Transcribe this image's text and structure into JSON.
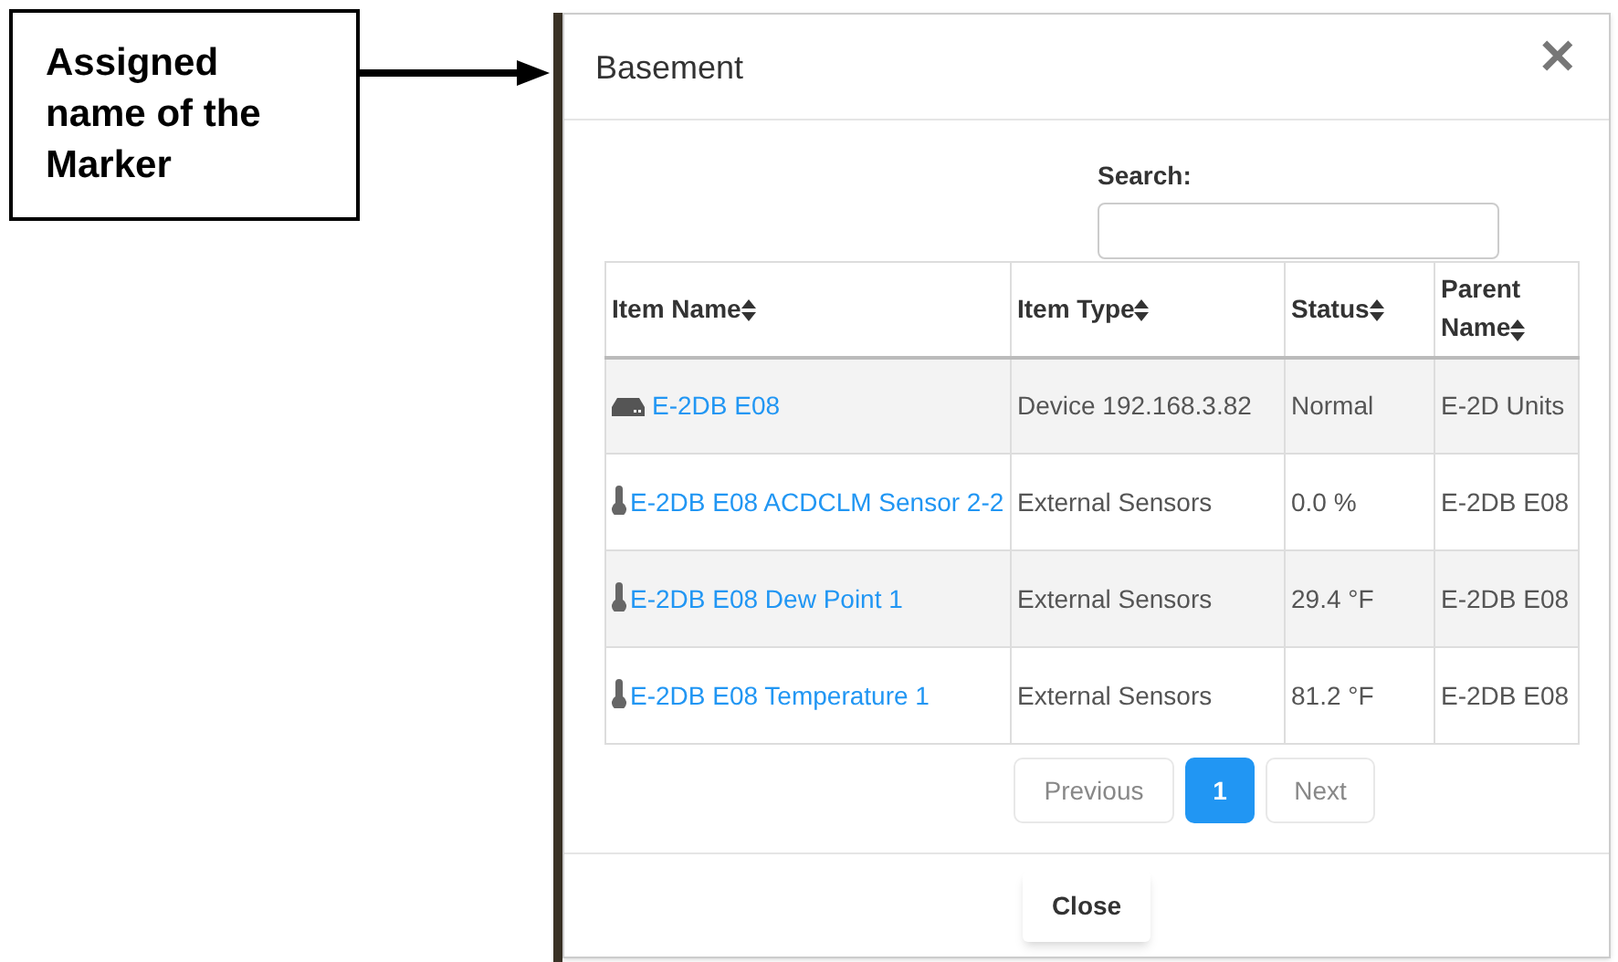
{
  "callout": {
    "text": "Assigned name of the Marker"
  },
  "dialog": {
    "title": "Basement",
    "close_icon": "✕",
    "search": {
      "label": "Search:"
    },
    "table": {
      "columns": [
        "Item Name",
        "Item Type",
        "Status",
        "Parent Name"
      ],
      "rows": [
        {
          "kind": "device",
          "name": "E-2DB E08",
          "type": "Device 192.168.3.82",
          "status": "Normal",
          "parent": "E-2D Units"
        },
        {
          "kind": "sensor",
          "name": "E-2DB E08 ACDCLM Sensor 2-2",
          "type": "External Sensors",
          "status": "0.0 %",
          "parent": "E-2DB E08"
        },
        {
          "kind": "sensor",
          "name": "E-2DB E08 Dew Point 1",
          "type": "External Sensors",
          "status": "29.4 °F",
          "parent": "E-2DB E08"
        },
        {
          "kind": "sensor",
          "name": "E-2DB E08 Temperature 1",
          "type": "External Sensors",
          "status": "81.2 °F",
          "parent": "E-2DB E08"
        }
      ]
    },
    "pagination": {
      "previous": {
        "label": "Previous",
        "disabled": true
      },
      "pages": [
        {
          "label": "1",
          "selected": true
        }
      ],
      "next": {
        "label": "Next",
        "disabled": true
      }
    },
    "footer": {
      "close_button": "Close"
    }
  }
}
